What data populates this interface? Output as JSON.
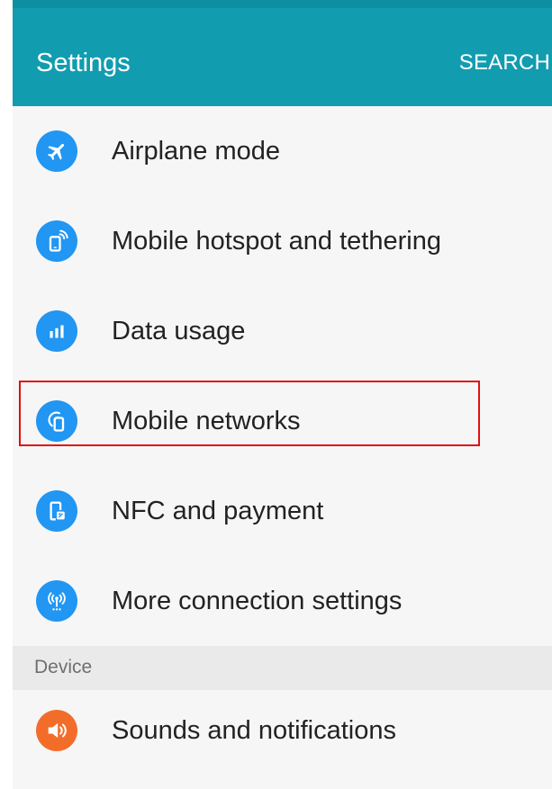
{
  "header": {
    "title": "Settings",
    "search_label": "SEARCH"
  },
  "colors": {
    "appbar": "#129cb0",
    "statusbar": "#0d8fa1",
    "blue_icon": "#2196f3",
    "orange_icon": "#f26d2a",
    "highlight": "#e01010"
  },
  "connections": {
    "items": [
      {
        "label": "Airplane mode",
        "icon": "airplane-icon"
      },
      {
        "label": "Mobile hotspot and tethering",
        "icon": "hotspot-icon"
      },
      {
        "label": "Data usage",
        "icon": "data-usage-icon"
      },
      {
        "label": "Mobile networks",
        "icon": "mobile-networks-icon",
        "highlighted": true
      },
      {
        "label": "NFC and payment",
        "icon": "nfc-icon"
      },
      {
        "label": "More connection settings",
        "icon": "more-connections-icon"
      }
    ]
  },
  "device": {
    "header": "Device",
    "items": [
      {
        "label": "Sounds and notifications",
        "icon": "sound-icon"
      }
    ]
  }
}
